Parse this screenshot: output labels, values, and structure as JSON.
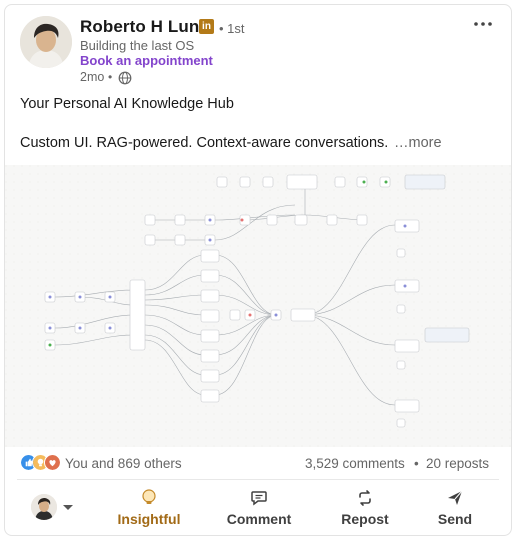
{
  "author": {
    "name": "Roberto H Luna",
    "badge_text": "in",
    "degree": "• 1st",
    "headline": "Building the last OS",
    "cta": "Book an appointment",
    "time": "2mo",
    "time_sep": "•",
    "visibility_icon": "globe-icon"
  },
  "post": {
    "line1": "Your Personal AI Knowledge Hub",
    "line2": "Custom UI. RAG-powered. Context-aware conversations.",
    "see_more": "…more",
    "media_alt": "workflow diagram"
  },
  "social": {
    "reaction_icons": [
      "like-icon",
      "insightful-icon",
      "love-icon"
    ],
    "reactions_text": "You and 869 others",
    "comments": "3,529 comments",
    "separator": "•",
    "reposts": "20 reposts"
  },
  "actions": {
    "insightful": "Insightful",
    "comment": "Comment",
    "repost": "Repost",
    "send": "Send"
  },
  "colors": {
    "brand_purple": "#8344cc",
    "insightful_gold": "#a26a16",
    "badge_gold": "#b37a18",
    "like_blue": "#378fe9",
    "love_red": "#df704d"
  }
}
